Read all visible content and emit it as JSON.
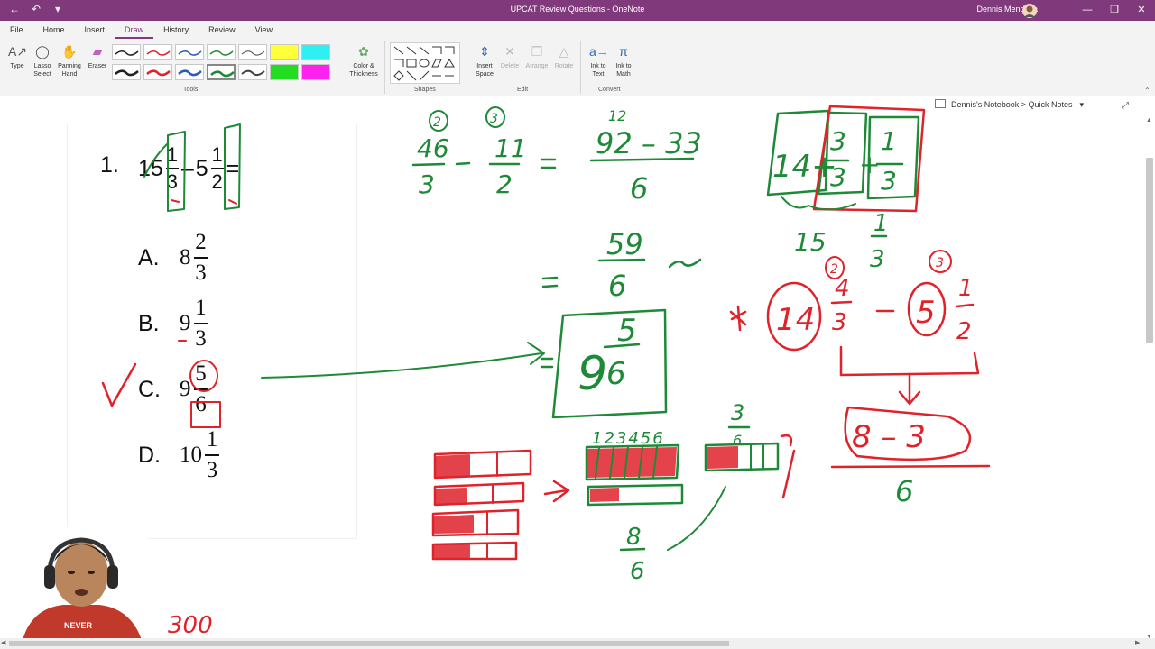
{
  "window": {
    "title": "UPCAT Review Questions - OneNote",
    "user": "Dennis Mendoza"
  },
  "tabs": [
    "File",
    "Home",
    "Insert",
    "Draw",
    "History",
    "Review",
    "View"
  ],
  "ribbon": {
    "tools": {
      "type": "Type",
      "lasso": "Lasso Select",
      "pan": "Panning Hand",
      "eraser": "Eraser",
      "color": "Color & Thickness",
      "label": "Tools"
    },
    "shapes_label": "Shapes",
    "edit": {
      "insert_space": "Insert Space",
      "delete": "Delete",
      "arrange": "Arrange",
      "rotate": "Rotate",
      "label": "Edit"
    },
    "convert": {
      "ink_text": "Ink to Text",
      "ink_math": "Ink to Math",
      "label": "Convert"
    }
  },
  "breadcrumb": "Dennis's Notebook > Quick Notes",
  "question": {
    "number": "1.",
    "expr": {
      "w1": "15",
      "n1": "1",
      "d1": "3",
      "op": "–",
      "w2": "5",
      "n2": "1",
      "d2": "2",
      "eq": "="
    },
    "options": [
      {
        "letter": "A.",
        "whole": "8",
        "num": "2",
        "den": "3"
      },
      {
        "letter": "B.",
        "whole": "9",
        "num": "1",
        "den": "3"
      },
      {
        "letter": "C.",
        "whole": "9",
        "num": "5",
        "den": "6"
      },
      {
        "letter": "D.",
        "whole": "10",
        "num": "1",
        "den": "3"
      }
    ]
  },
  "ink": {
    "top_a": {
      "n": "46",
      "d": "3",
      "c": "2"
    },
    "top_b": {
      "n": "11",
      "d": "2",
      "c": "3"
    },
    "top_c": {
      "n": "92 – 33",
      "d": "6",
      "sup": "12"
    },
    "mid": {
      "n": "59",
      "d": "6"
    },
    "answer": {
      "w": "9",
      "n": "5",
      "d": "6"
    },
    "box_right": {
      "w": "14+",
      "n1": "3",
      "d1": "3",
      "n2": "1",
      "d2": "3"
    },
    "r15": "15",
    "r13": {
      "n": "1",
      "d": "3"
    },
    "rmid": {
      "w1": "14",
      "n1": "4",
      "d1": "3",
      "w2": "5",
      "n2": "1",
      "d2": "2",
      "c1": "2",
      "c2": "3"
    },
    "rbot": {
      "n": "8 – 3",
      "d": "6"
    },
    "bars_top": "123456",
    "bars_frac": {
      "n": "8",
      "d": "6"
    },
    "bar3": {
      "n": "3",
      "d": "6"
    },
    "note": "300"
  },
  "colors": {
    "accent": "#80397b",
    "ink_green": "#1e8a38",
    "ink_red": "#e0222b"
  }
}
